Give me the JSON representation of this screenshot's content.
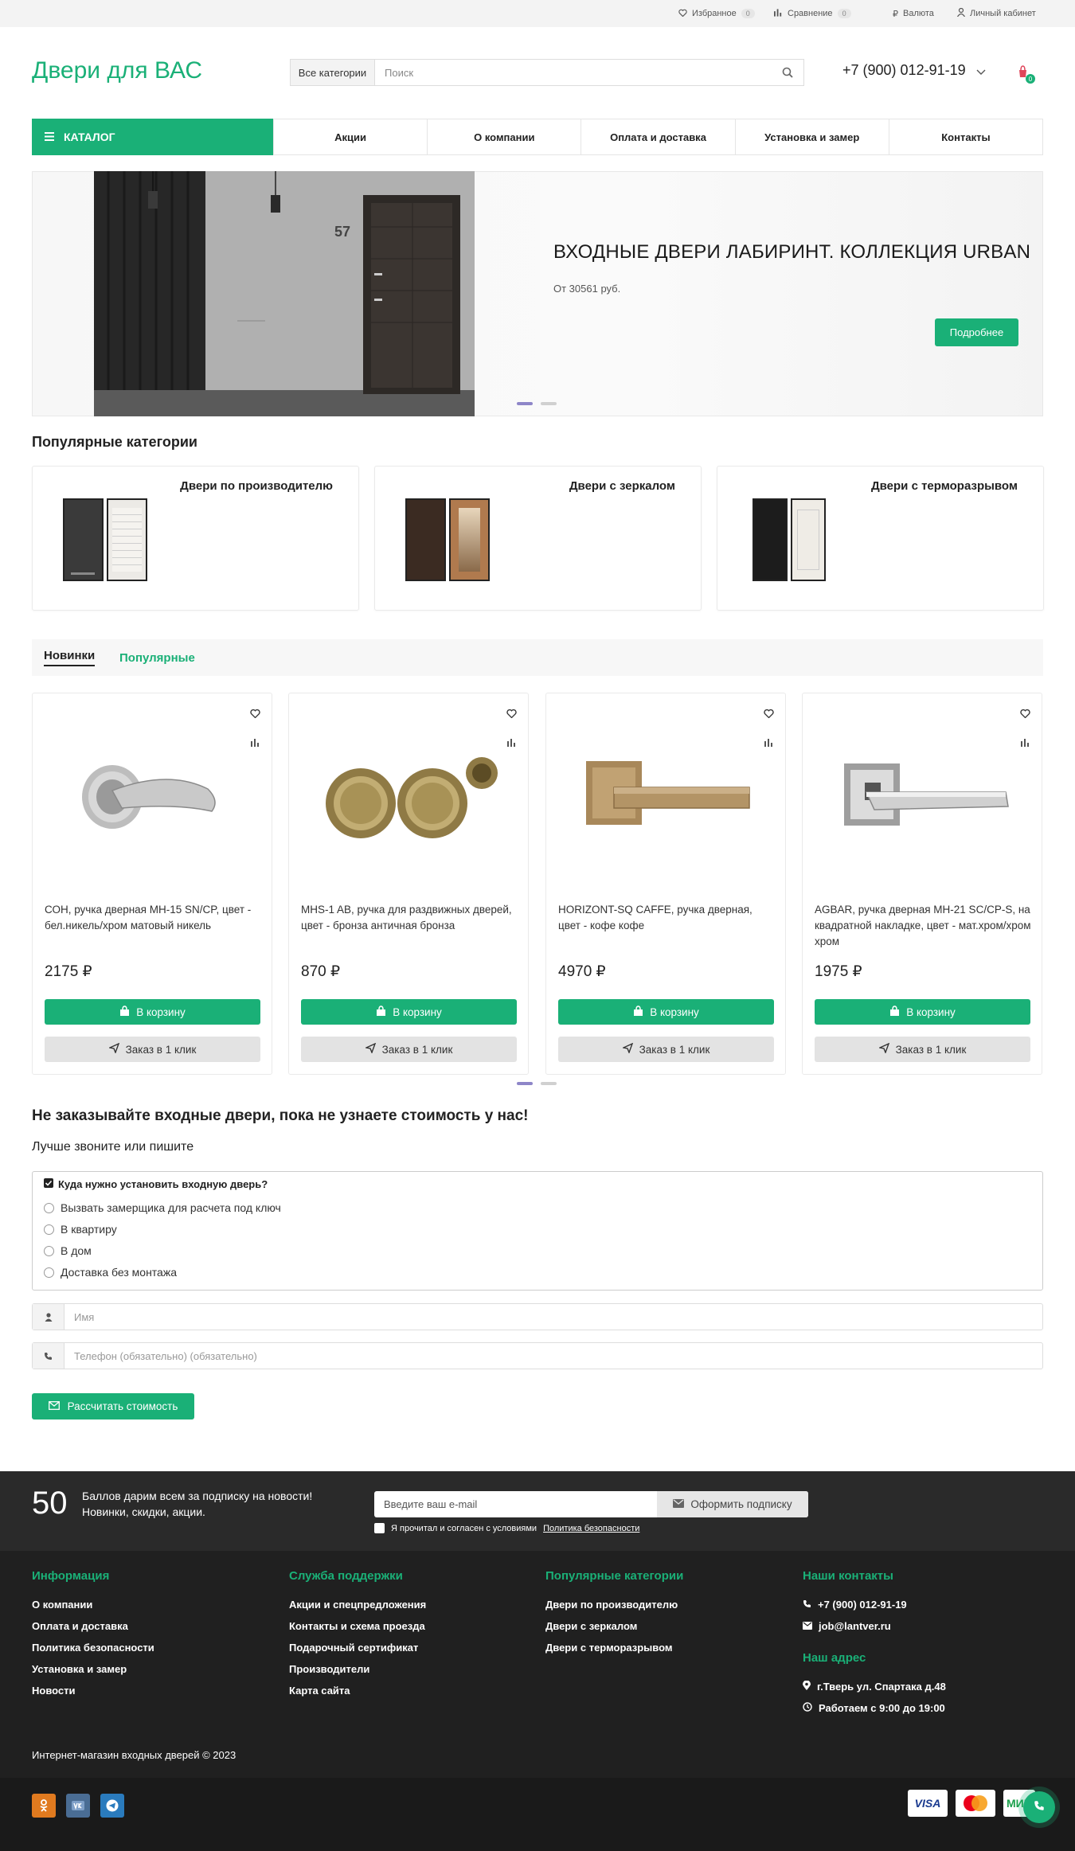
{
  "topbar": {
    "favorites_label": "Избранное",
    "favorites_count": "0",
    "compare_label": "Сравнение",
    "compare_count": "0",
    "currency_label": "Валюта",
    "account_label": "Личный кабинет"
  },
  "header": {
    "logo": "Двери для ВАС",
    "search_category": "Все категории",
    "search_placeholder": "Поиск",
    "phone": "+7 (900) 012-91-19",
    "cart_count": "0"
  },
  "nav": {
    "catalog": "КАТАЛОГ",
    "items": [
      "Акции",
      "О компании",
      "Оплата и доставка",
      "Установка и замер",
      "Контакты"
    ]
  },
  "hero": {
    "title": "ВХОДНЫЕ ДВЕРИ ЛАБИРИНТ. КОЛЛЕКЦИЯ URBAN",
    "price": "От 30561 руб.",
    "button": "Подробнее",
    "door_number": "57"
  },
  "popular": {
    "title": "Популярные категории",
    "items": [
      {
        "title": "Двери по производителю"
      },
      {
        "title": "Двери с зеркалом"
      },
      {
        "title": "Двери с терморазрывом"
      }
    ]
  },
  "tabs": {
    "new": "Новинки",
    "popular": "Популярные"
  },
  "products": [
    {
      "name": "СОН, ручка дверная MH-15 SN/CP, цвет - бел.никель/хром матовый никель",
      "price": "2175 ₽"
    },
    {
      "name": "MHS-1 AB, ручка для раздвижных дверей, цвет - бронза античная бронза",
      "price": "870 ₽"
    },
    {
      "name": "HORIZONT-SQ CAFFE, ручка дверная, цвет - кофе кофе",
      "price": "4970 ₽"
    },
    {
      "name": "AGBAR, ручка дверная MH-21 SC/CP-S, на квадратной накладке, цвет - мат.хром/хром хром",
      "price": "1975 ₽"
    }
  ],
  "product_buttons": {
    "buy": "В корзину",
    "one_click": "Заказ в 1 клик"
  },
  "form": {
    "heading": "Не заказывайте входные двери, пока не узнаете стоимость у нас!",
    "subheading": "Лучше звоните или пишите",
    "question": "Куда нужно установить входную дверь?",
    "options": [
      "Вызвать замерщика для расчета под ключ",
      "В квартиру",
      "В дом",
      "Доставка без монтажа"
    ],
    "name_placeholder": "Имя",
    "phone_placeholder": "Телефон (обязательно) (обязательно)",
    "submit": "Рассчитать стоимость"
  },
  "subscribe": {
    "number": "50",
    "line1": "Баллов дарим всем за подписку на новости!",
    "line2": "Новинки, скидки, акции.",
    "email_placeholder": "Введите ваш e-mail",
    "button": "Оформить подписку",
    "agree_text": "Я прочитал и согласен с условиями",
    "agree_link": "Политика безопасности"
  },
  "footer": {
    "info": {
      "title": "Информация",
      "links": [
        "О компании",
        "Оплата и доставка",
        "Политика безопасности",
        "Установка и замер",
        "Новости"
      ]
    },
    "support": {
      "title": "Служба поддержки",
      "links": [
        "Акции и спецпредложения",
        "Контакты и схема проезда",
        "Подарочный сертификат",
        "Производители",
        "Карта сайта"
      ]
    },
    "categories": {
      "title": "Популярные категории",
      "links": [
        "Двери по производителю",
        "Двери с зеркалом",
        "Двери с терморазрывом"
      ]
    },
    "contacts": {
      "title": "Наши контакты",
      "phone": "+7 (900) 012-91-19",
      "email": "job@lantver.ru"
    },
    "address": {
      "title": "Наш адрес",
      "address": "г.Тверь ул. Спартака д.48",
      "hours": "Работаем с 9:00 до 19:00"
    },
    "copyright": "Интернет-магазин входных дверей © 2023"
  },
  "payments": {
    "visa": "VISA",
    "mir": "МИР"
  },
  "colors": {
    "accent": "#1ab077",
    "footer_bg": "#202020"
  }
}
